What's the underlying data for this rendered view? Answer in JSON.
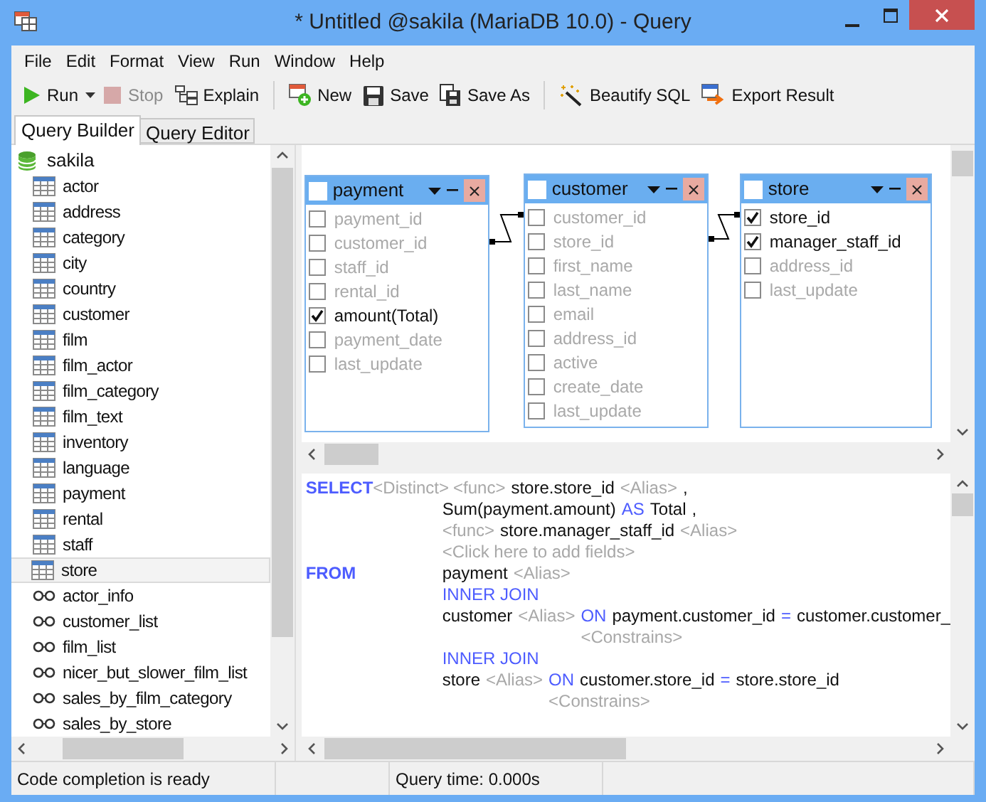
{
  "window": {
    "title": "* Untitled @sakila (MariaDB 10.0) - Query"
  },
  "menu": [
    "File",
    "Edit",
    "Format",
    "View",
    "Run",
    "Window",
    "Help"
  ],
  "toolbar": [
    {
      "kind": "run",
      "label": "Run",
      "disabled": false
    },
    {
      "kind": "stop",
      "label": "Stop",
      "disabled": true
    },
    {
      "kind": "explain",
      "label": "Explain",
      "disabled": false
    },
    {
      "kind": "new",
      "label": "New",
      "disabled": false
    },
    {
      "kind": "save",
      "label": "Save",
      "disabled": false
    },
    {
      "kind": "saveas",
      "label": "Save As",
      "disabled": false
    },
    {
      "kind": "beautify",
      "label": "Beautify SQL",
      "disabled": false
    },
    {
      "kind": "export",
      "label": "Export Result",
      "disabled": false
    }
  ],
  "tabs": [
    {
      "label": "Query Builder",
      "selected": true
    },
    {
      "label": "Query Editor",
      "selected": false
    }
  ],
  "tree": {
    "label": "sakila",
    "children": [
      {
        "label": "actor",
        "kind": "table",
        "selected": false
      },
      {
        "label": "address",
        "kind": "table",
        "selected": false
      },
      {
        "label": "category",
        "kind": "table",
        "selected": false
      },
      {
        "label": "city",
        "kind": "table",
        "selected": false
      },
      {
        "label": "country",
        "kind": "table",
        "selected": false
      },
      {
        "label": "customer",
        "kind": "table",
        "selected": false
      },
      {
        "label": "film",
        "kind": "table",
        "selected": false
      },
      {
        "label": "film_actor",
        "kind": "table",
        "selected": false
      },
      {
        "label": "film_category",
        "kind": "table",
        "selected": false
      },
      {
        "label": "film_text",
        "kind": "table",
        "selected": false
      },
      {
        "label": "inventory",
        "kind": "table",
        "selected": false
      },
      {
        "label": "language",
        "kind": "table",
        "selected": false
      },
      {
        "label": "payment",
        "kind": "table",
        "selected": false
      },
      {
        "label": "rental",
        "kind": "table",
        "selected": false
      },
      {
        "label": "staff",
        "kind": "table",
        "selected": false
      },
      {
        "label": "store",
        "kind": "table",
        "selected": true
      },
      {
        "label": "actor_info",
        "kind": "view",
        "selected": false
      },
      {
        "label": "customer_list",
        "kind": "view",
        "selected": false
      },
      {
        "label": "film_list",
        "kind": "view",
        "selected": false
      },
      {
        "label": "nicer_but_slower_film_list",
        "kind": "view",
        "selected": false
      },
      {
        "label": "sales_by_film_category",
        "kind": "view",
        "selected": false
      },
      {
        "label": "sales_by_store",
        "kind": "view",
        "selected": false
      }
    ]
  },
  "diagram": {
    "tables": [
      {
        "name": "payment",
        "checked": false,
        "fields": [
          {
            "name": "payment_id",
            "checked": false
          },
          {
            "name": "customer_id",
            "checked": false
          },
          {
            "name": "staff_id",
            "checked": false
          },
          {
            "name": "rental_id",
            "checked": false
          },
          {
            "name": "amount(Total)",
            "checked": true
          },
          {
            "name": "payment_date",
            "checked": false
          },
          {
            "name": "last_update",
            "checked": false
          }
        ]
      },
      {
        "name": "customer",
        "checked": false,
        "fields": [
          {
            "name": "customer_id",
            "checked": false
          },
          {
            "name": "store_id",
            "checked": false
          },
          {
            "name": "first_name",
            "checked": false
          },
          {
            "name": "last_name",
            "checked": false
          },
          {
            "name": "email",
            "checked": false
          },
          {
            "name": "address_id",
            "checked": false
          },
          {
            "name": "active",
            "checked": false
          },
          {
            "name": "create_date",
            "checked": false
          },
          {
            "name": "last_update",
            "checked": false
          }
        ]
      },
      {
        "name": "store",
        "checked": false,
        "fields": [
          {
            "name": "store_id",
            "checked": true
          },
          {
            "name": "manager_staff_id",
            "checked": true
          },
          {
            "name": "address_id",
            "checked": false
          },
          {
            "name": "last_update",
            "checked": false
          }
        ]
      }
    ]
  },
  "sql": [
    {
      "clause": "SELECT",
      "prefix": [
        {
          "kind": "placeholder",
          "text": "<Distinct>"
        }
      ],
      "tokens": [
        {
          "kind": "placeholder",
          "text": "<func>"
        },
        {
          "kind": "text",
          "text": "store.store_id"
        },
        {
          "kind": "placeholder",
          "text": "<Alias>"
        },
        {
          "kind": "text",
          "text": ","
        }
      ]
    },
    {
      "tokens": [
        {
          "kind": "text",
          "text": "Sum(payment.amount)"
        },
        {
          "kind": "keyword",
          "text": "AS"
        },
        {
          "kind": "text",
          "text": "Total"
        },
        {
          "kind": "text",
          "text": ","
        }
      ]
    },
    {
      "tokens": [
        {
          "kind": "placeholder",
          "text": "<func>"
        },
        {
          "kind": "text",
          "text": "store.manager_staff_id"
        },
        {
          "kind": "placeholder",
          "text": "<Alias>"
        }
      ]
    },
    {
      "tokens": [
        {
          "kind": "placeholder",
          "text": "<Click here to add fields>"
        }
      ]
    },
    {
      "clause": "FROM",
      "tokens": [
        {
          "kind": "text",
          "text": "payment"
        },
        {
          "kind": "placeholder",
          "text": "<Alias>"
        }
      ]
    },
    {
      "tokens": [
        {
          "kind": "keyword",
          "text": "INNER JOIN"
        }
      ]
    },
    {
      "tokens": [
        {
          "kind": "text",
          "text": "customer"
        },
        {
          "kind": "placeholder",
          "text": "<Alias>"
        }
      ],
      "on": [
        {
          "kind": "keyword",
          "text": "ON"
        },
        {
          "kind": "text",
          "text": "payment.customer_id"
        },
        {
          "kind": "keyword",
          "text": "="
        },
        {
          "kind": "text",
          "text": "customer.customer_"
        }
      ],
      "constraints": "<Constrains>"
    },
    {
      "tokens": [
        {
          "kind": "keyword",
          "text": "INNER JOIN"
        }
      ]
    },
    {
      "tokens": [
        {
          "kind": "text",
          "text": "store"
        },
        {
          "kind": "placeholder",
          "text": "<Alias>"
        }
      ],
      "on": [
        {
          "kind": "keyword",
          "text": "ON"
        },
        {
          "kind": "text",
          "text": "customer.store_id"
        },
        {
          "kind": "keyword",
          "text": "="
        },
        {
          "kind": "text",
          "text": "store.store_id"
        }
      ],
      "constraints": "<Constrains>"
    }
  ],
  "status_bar": [
    {
      "text": "Code completion is ready"
    },
    {
      "text": "Query time: 0.000s"
    }
  ]
}
